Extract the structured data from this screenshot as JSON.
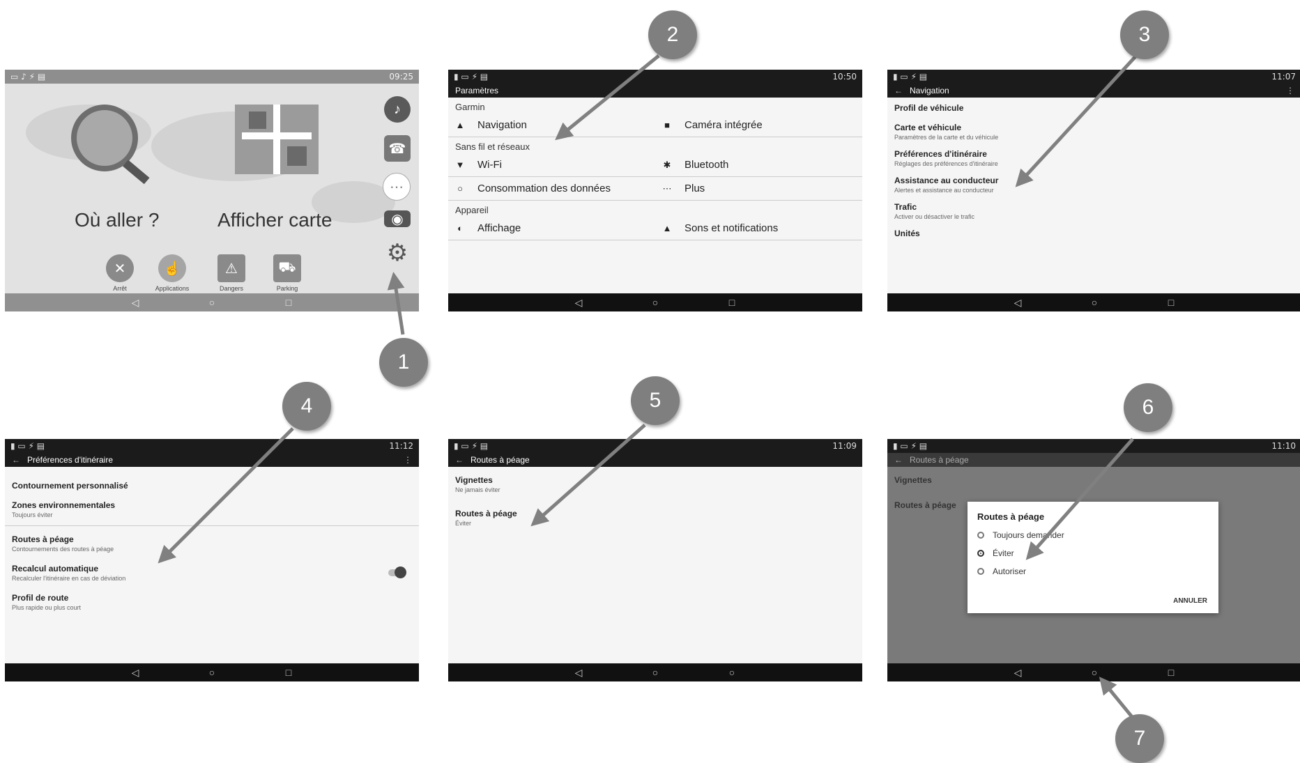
{
  "callouts": [
    "1",
    "2",
    "3",
    "4",
    "5",
    "6",
    "7"
  ],
  "colors": {
    "callout": "#7f7f7f",
    "arrow": "#808080",
    "bars": "#1b1b1b"
  },
  "screen1": {
    "status_time": "09:25",
    "where_to": "Où aller ?",
    "show_map": "Afficher carte",
    "apps": [
      "Arrêt",
      "Applications",
      "Dangers",
      "Parking"
    ],
    "icons": [
      "magnifier-icon",
      "map-icon",
      "music-icon",
      "phone-icon",
      "apps-icon",
      "camera-icon",
      "settings-gear-icon"
    ]
  },
  "screen2": {
    "status_time": "10:50",
    "title": "Paramètres",
    "sections": {
      "device_nav": "Garmin",
      "wireless": "Sans fil et réseaux",
      "device": "Appareil"
    },
    "items": {
      "navigation": "Navigation",
      "camera": "Caméra intégrée",
      "wifi": "Wi-Fi",
      "bluetooth": "Bluetooth",
      "data": "Consommation des données",
      "more": "Plus",
      "display": "Affichage",
      "sounds": "Sons et notifications"
    }
  },
  "screen3": {
    "status_time": "11:07",
    "title": "Navigation",
    "prefs": [
      {
        "title": "Profil de véhicule",
        "sub": ""
      },
      {
        "title": "Carte et véhicule",
        "sub": "Paramètres de la carte et du véhicule"
      },
      {
        "title": "Préférences d'itinéraire",
        "sub": "Réglages des préférences d'itinéraire"
      },
      {
        "title": "Assistance au conducteur",
        "sub": "Alertes et assistance au conducteur"
      },
      {
        "title": "Trafic",
        "sub": "Activer ou désactiver le trafic"
      },
      {
        "title": "Unités",
        "sub": ""
      }
    ]
  },
  "screen4": {
    "status_time": "11:12",
    "title": "Préférences d'itinéraire",
    "prefs": [
      {
        "title": "Contournement personnalisé",
        "sub": ""
      },
      {
        "title": "Zones environnementales",
        "sub": "Toujours éviter"
      },
      {
        "title": "Routes à péage",
        "sub": "Contournements des routes à péage"
      },
      {
        "title": "Recalcul automatique",
        "sub": "Recalculer l'itinéraire en cas de déviation"
      },
      {
        "title": "Profil de route",
        "sub": "Plus rapide ou plus court"
      }
    ]
  },
  "screen5": {
    "status_time": "11:09",
    "title": "Routes à péage",
    "prefs": [
      {
        "title": "Vignettes",
        "sub": "Ne jamais éviter"
      },
      {
        "title": "Routes à péage",
        "sub": "Éviter"
      }
    ]
  },
  "screen6": {
    "status_time": "11:10",
    "title": "Routes à péage",
    "dialog_title": "Routes à péage",
    "options": [
      "Toujours demander",
      "Éviter",
      "Autoriser"
    ],
    "selected": 1,
    "cancel": "ANNULER",
    "bg_prefs": [
      "Vignettes",
      "Routes à péage"
    ]
  },
  "nav_glyphs": {
    "back": "◁",
    "home": "○",
    "recent": "□"
  }
}
